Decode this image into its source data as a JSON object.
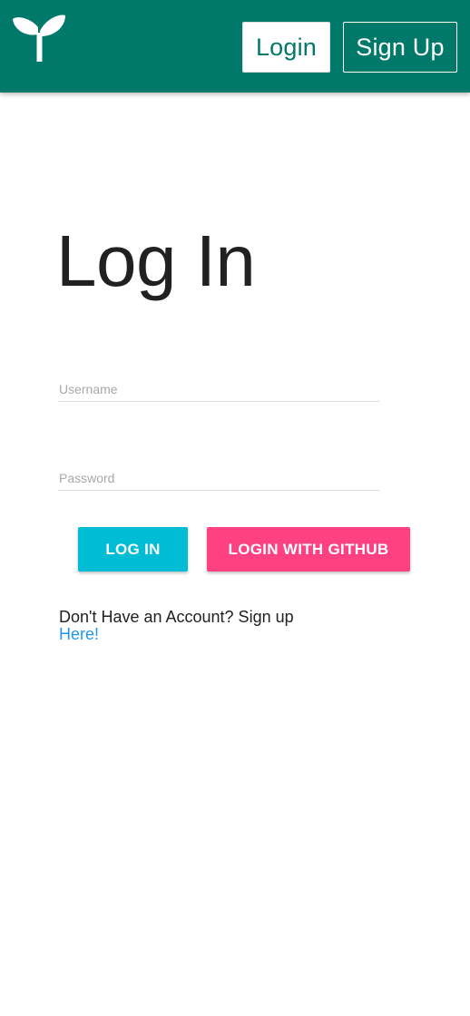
{
  "navbar": {
    "logo_icon": "sprout-icon",
    "login_label": "Login",
    "signup_label": "Sign Up"
  },
  "page": {
    "title": "Log In"
  },
  "form": {
    "username_placeholder": "Username",
    "password_placeholder": "Password",
    "login_button_label": "LOG IN",
    "github_button_label": "LOGIN WITH GITHUB"
  },
  "signup_prompt": {
    "text": "Don't Have an Account? Sign up",
    "link_text": "Here!"
  },
  "colors": {
    "navbar": "#00796b",
    "login_button": "#00bcd4",
    "github_button": "#ff4081",
    "link": "#2196f3"
  }
}
